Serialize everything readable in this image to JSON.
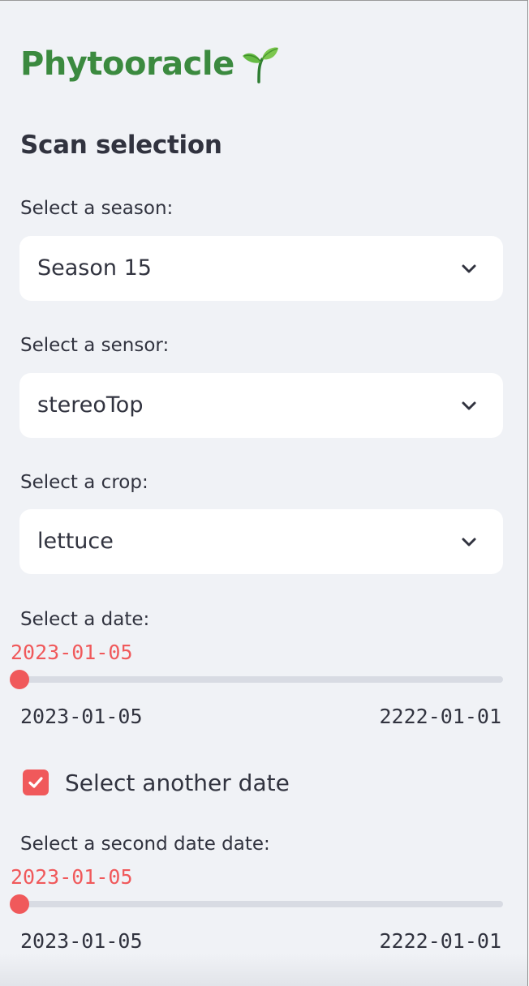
{
  "app": {
    "title": "Phytooracle",
    "title_icon": "sprout-icon",
    "title_color": "#3b8a3f"
  },
  "section": {
    "heading": "Scan selection"
  },
  "season": {
    "label": "Select a season:",
    "value": "Season 15",
    "icon": "chevron-down-icon"
  },
  "sensor": {
    "label": "Select a sensor:",
    "value": "stereoTop",
    "icon": "chevron-down-icon"
  },
  "crop": {
    "label": "Select a crop:",
    "value": "lettuce",
    "icon": "chevron-down-icon"
  },
  "date1": {
    "label": "Select a date:",
    "current": "2023-01-05",
    "min": "2023-01-05",
    "max": "2222-01-01",
    "position_fraction": 0.0
  },
  "another_date": {
    "label": "Select another date",
    "checked": true
  },
  "date2": {
    "label": "Select a second date date:",
    "current": "2023-01-05",
    "min": "2023-01-05",
    "max": "2222-01-01",
    "position_fraction": 0.0
  },
  "colors": {
    "accent": "#f0595b",
    "background": "#f0f2f6",
    "text": "#31333f",
    "track": "#d8dbe3"
  }
}
